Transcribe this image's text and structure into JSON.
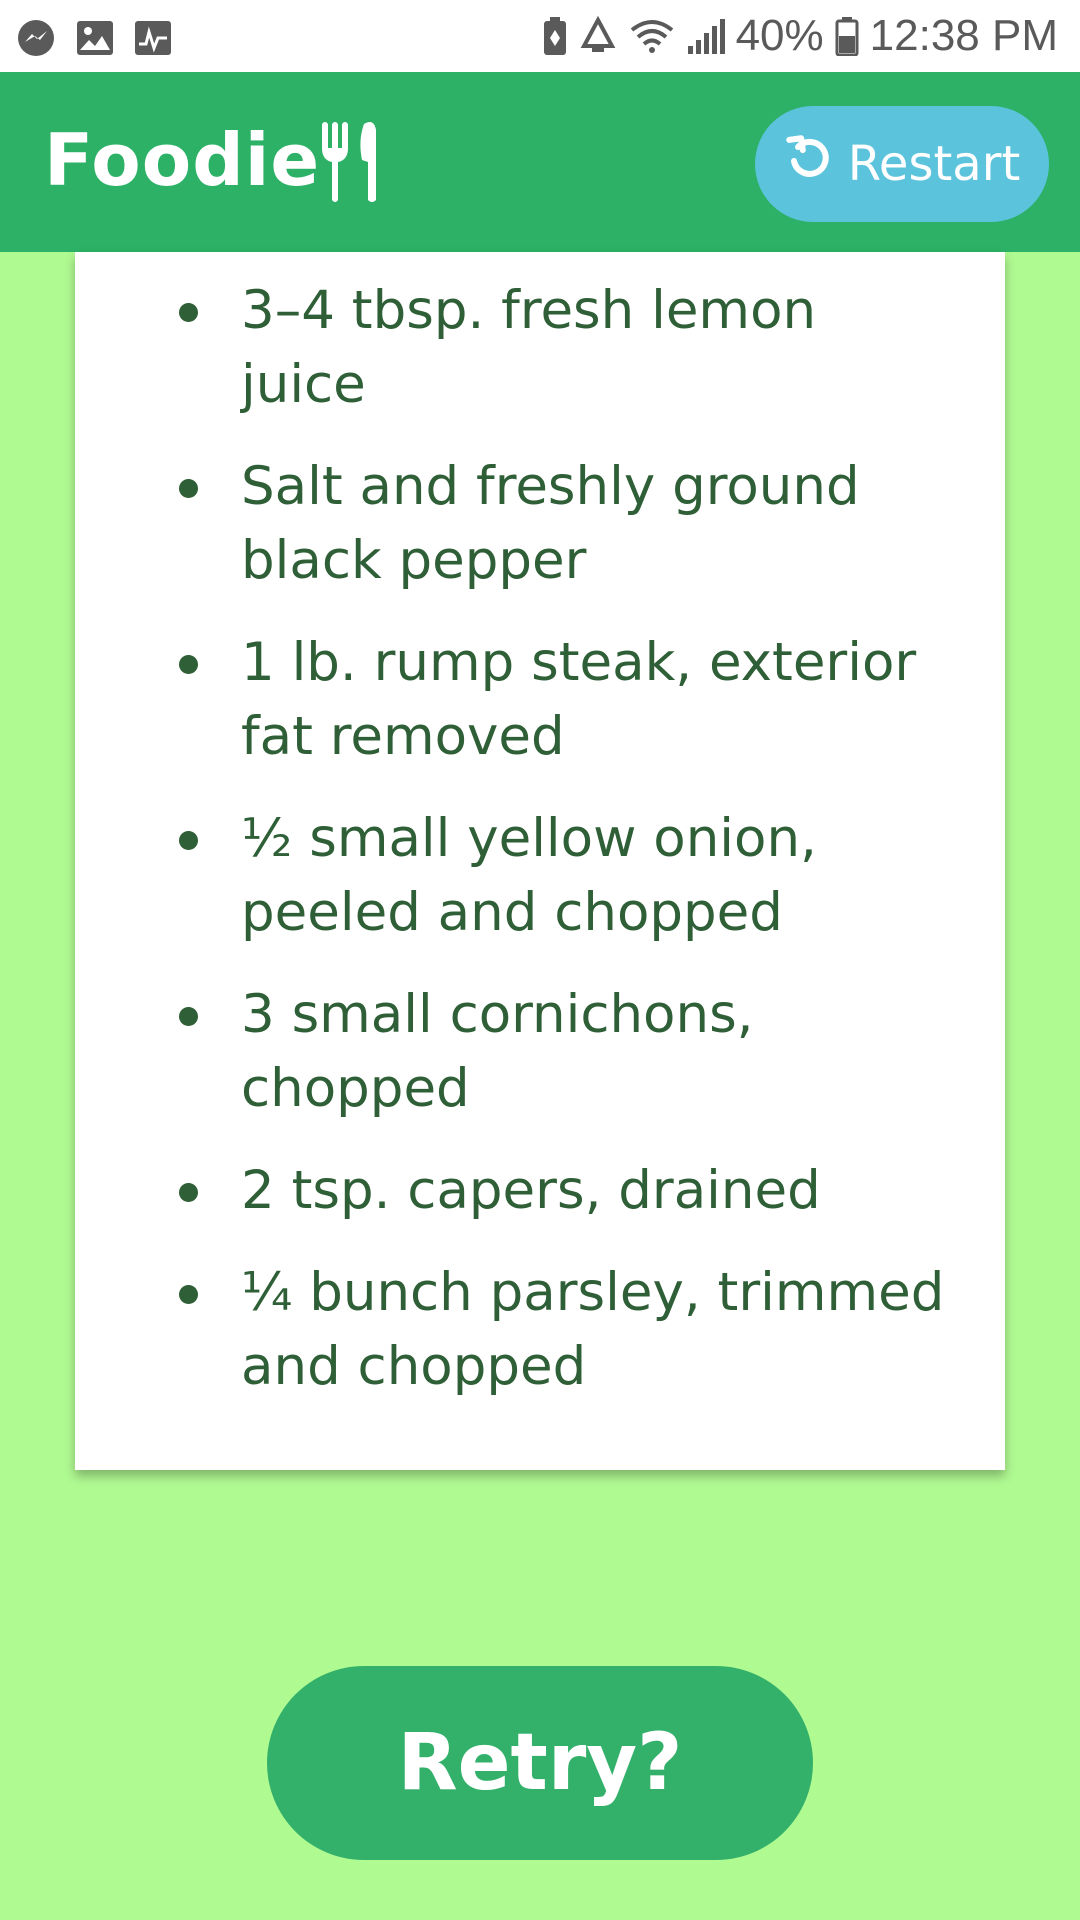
{
  "status_bar": {
    "battery_percent": "40%",
    "time": "12:38 PM",
    "left_icons": [
      "messenger-icon",
      "image-icon",
      "activity-icon"
    ],
    "right_icons": [
      "battery-saver-icon",
      "recycle-icon",
      "wifi-icon",
      "signal-icon",
      "battery-icon"
    ]
  },
  "app_bar": {
    "title": "Foodie",
    "title_icon": "fork-knife-icon",
    "restart_label": "Restart",
    "restart_icon": "restart-icon",
    "color": "#2cb166"
  },
  "ingredients": [
    {
      "text": "3–4 tbsp. fresh lemon juice"
    },
    {
      "text": "Salt and freshly ground black pepper"
    },
    {
      "text": "1 lb. rump steak, exterior fat removed"
    },
    {
      "text": "½ small yellow onion, peeled and chopped"
    },
    {
      "text": "3 small cornichons, chopped"
    },
    {
      "text": "2 tsp. capers, drained"
    },
    {
      "text": "¼ bunch parsley, trimmed and chopped"
    }
  ],
  "retry_label": "Retry?",
  "colors": {
    "background": "#b0fa92",
    "restart_button": "#5cc3dc",
    "retry_button": "#33b16a",
    "text": "#2f5f37"
  }
}
